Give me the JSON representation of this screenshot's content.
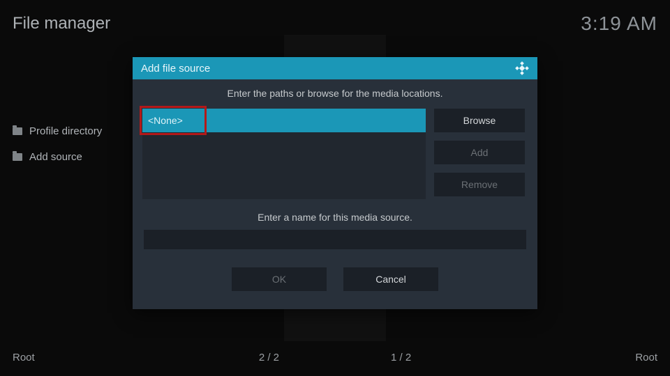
{
  "header": {
    "title": "File manager",
    "clock": "3:19 AM"
  },
  "sidebar": {
    "items": [
      {
        "label": "Profile directory"
      },
      {
        "label": "Add source"
      }
    ]
  },
  "dialog": {
    "title": "Add file source",
    "instruction": "Enter the paths or browse for the media locations.",
    "path_value": "<None>",
    "browse_label": "Browse",
    "add_label": "Add",
    "remove_label": "Remove",
    "name_prompt": "Enter a name for this media source.",
    "name_value": "",
    "ok_label": "OK",
    "cancel_label": "Cancel"
  },
  "footer": {
    "left_label": "Root",
    "counter_left": "2 / 2",
    "counter_right": "1 / 2",
    "right_label": "Root"
  }
}
